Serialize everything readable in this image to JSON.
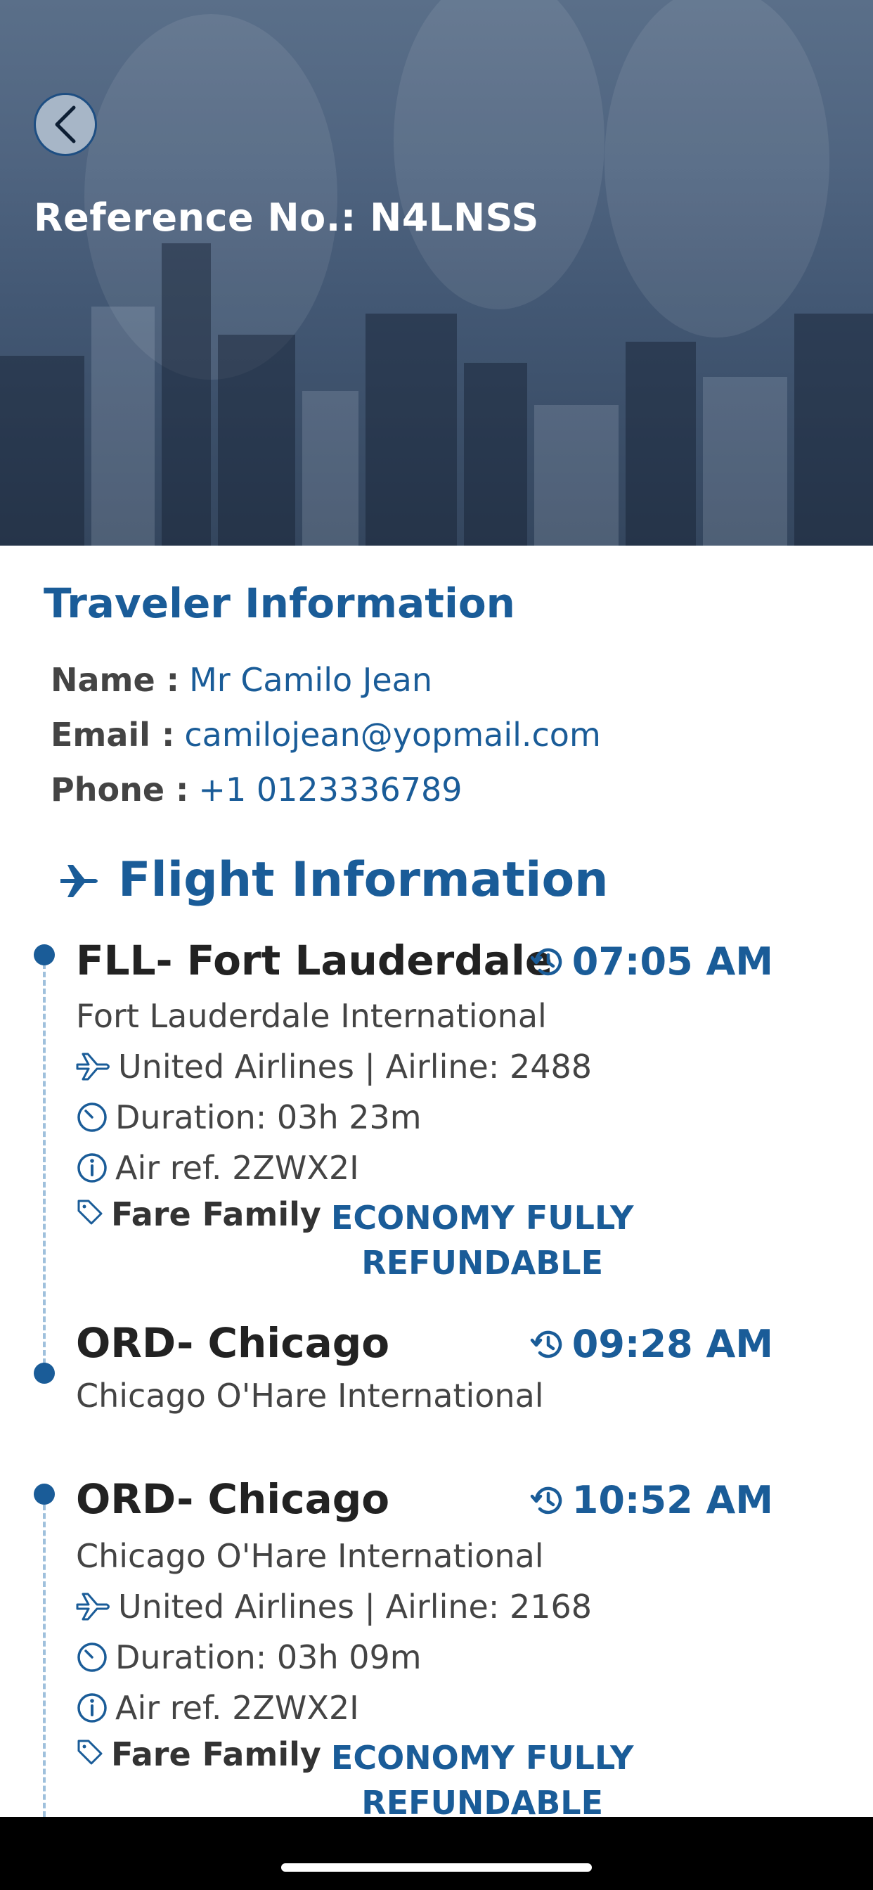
{
  "header": {
    "reference_label": "Reference No.: N4LNSS"
  },
  "traveler": {
    "title": "Traveler Information",
    "name_label": "Name :",
    "name_value": "Mr Camilo Jean",
    "email_label": "Email :",
    "email_value": "camilojean@yopmail.com",
    "phone_label": "Phone :",
    "phone_value": "+1 0123336789"
  },
  "flight": {
    "title": "Flight Information",
    "segments": [
      {
        "departure": {
          "city": "FLL- Fort Lauderdale",
          "time": "07:05 AM",
          "airport": "Fort Lauderdale International"
        },
        "airline": "United Airlines | Airline: 2488",
        "duration": "Duration: 03h 23m",
        "air_ref": "Air ref. 2ZWX2I",
        "fare_label": "Fare Family",
        "fare_line1": "ECONOMY FULLY",
        "fare_line2": "REFUNDABLE",
        "arrival": {
          "city": "ORD- Chicago",
          "time": "09:28 AM",
          "airport": "Chicago O'Hare International"
        }
      },
      {
        "departure": {
          "city": "ORD- Chicago",
          "time": "10:52 AM",
          "airport": "Chicago O'Hare International"
        },
        "airline": "United Airlines | Airline: 2168",
        "duration": "Duration: 03h 09m",
        "air_ref": "Air ref. 2ZWX2I",
        "fare_label": "Fare Family",
        "fare_line1": "ECONOMY FULLY",
        "fare_line2": "REFUNDABLE"
      }
    ]
  },
  "icons": {
    "back": "chevron-left-icon",
    "section_plane": "airplane-icon",
    "time": "history-clock-icon",
    "airline": "plane-outline-icon",
    "duration": "timer-icon",
    "info": "info-icon",
    "tag": "tag-icon"
  },
  "colors": {
    "primary": "#1a5c98",
    "timeline": "#9fc0dc",
    "text": "#333333"
  }
}
